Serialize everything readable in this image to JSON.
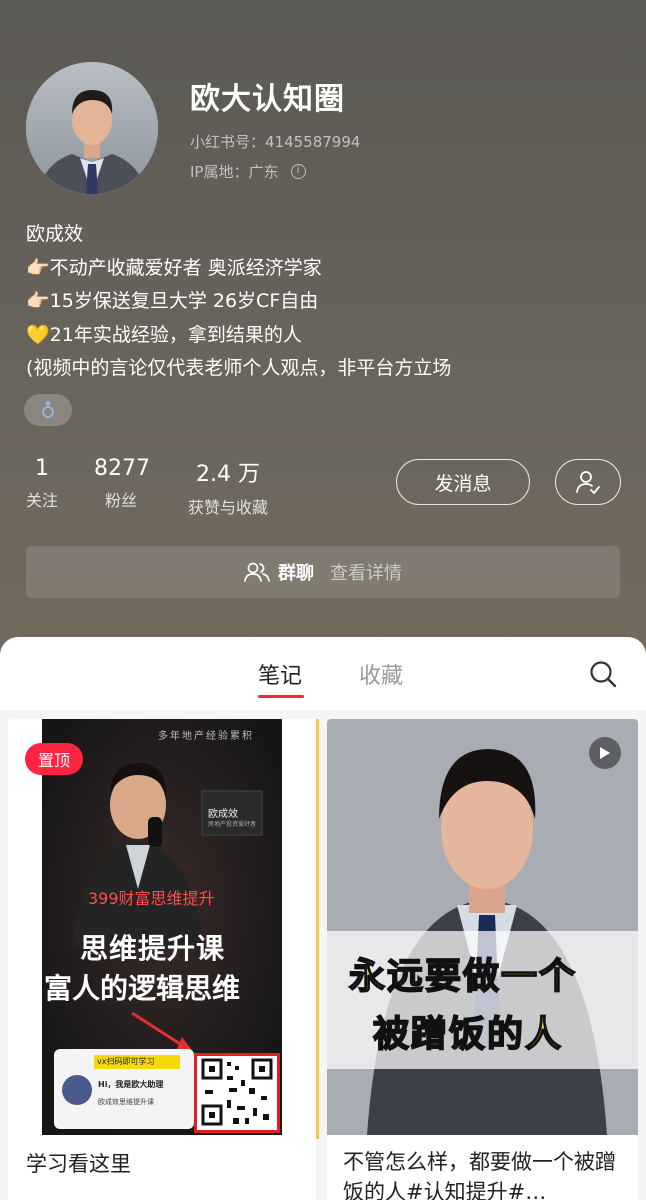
{
  "profile": {
    "name": "欧大认知圈",
    "id_text": "小红书号：4145587994",
    "ip_label": "IP属地：",
    "ip_value": "广东",
    "bio": [
      "欧成效",
      "👉🏻不动产收藏爱好者 奥派经济学家",
      "👉🏻15岁保送复旦大学 26岁CF自由",
      "💛21年实战经验，拿到结果的人",
      "(视频中的言论仅代表老师个人观点，非平台方立场"
    ],
    "gender_icon": "male-icon"
  },
  "stats": {
    "following_num": "1",
    "following_label": "关注",
    "fans_num": "8277",
    "fans_label": "粉丝",
    "likes_num": "2.4 万",
    "likes_label": "获赞与收藏"
  },
  "actions": {
    "message_label": "发消息",
    "follow_icon": "user-check-icon"
  },
  "group": {
    "title": "群聊",
    "detail": "查看详情"
  },
  "tabs": {
    "notes": "笔记",
    "collections": "收藏",
    "active": "笔记"
  },
  "notes": [
    {
      "pinned_label": "置顶",
      "title": "学习看这里",
      "cover": {
        "top_text": "多年地产经验累积",
        "name_tag": "欧成效",
        "name_sub": "房地产投资爱好者",
        "price_line": "399财富思维提升",
        "headline_1": "思维提升课",
        "headline_2": "富人的逻辑思维",
        "scan_tip": "vx扫码即可学习",
        "assistant_greeting": "Hi，我是欧大助理",
        "assistant_sub": "欧成效思维提升课"
      }
    },
    {
      "title": "不管怎么样，都要做一个被蹭饭的人#认知提升#…",
      "cover": {
        "headline_1": "永远要做一个",
        "headline_2": "被蹭饭的人"
      }
    }
  ],
  "colors": {
    "accent": "#ff2442",
    "caption_yellow": "#f5d90a"
  }
}
